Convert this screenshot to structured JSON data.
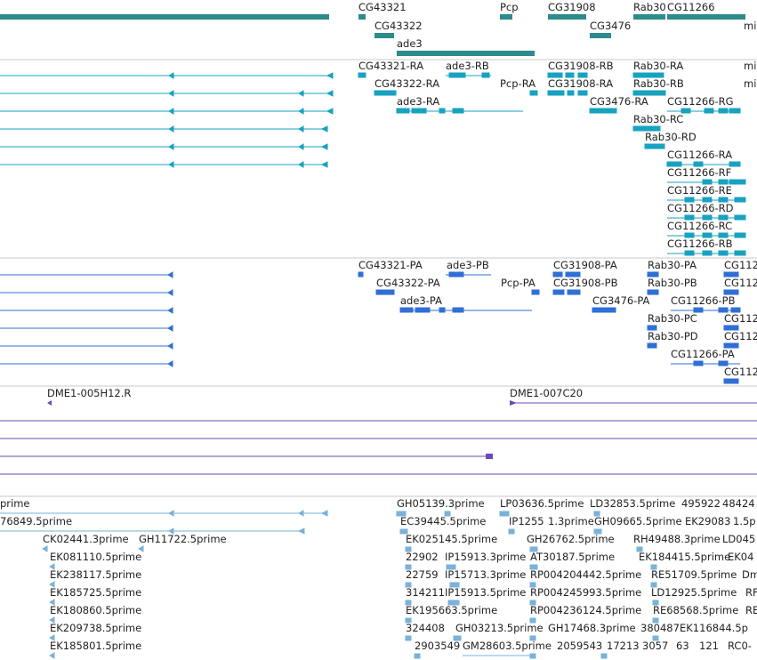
{
  "colors": {
    "gene": "#2e8b8b",
    "mrna": "#17a2bf",
    "protein": "#2f6fd6",
    "clone": "#6a4bb5",
    "est": "#7ab2d8",
    "separator": "#c8c8c8"
  },
  "tracks": {
    "genes": {
      "labels": [
        "CG43321",
        "Pcp",
        "CG31908",
        "Rab30",
        "CG11266",
        "CG43322",
        "CG3476",
        "ade3",
        "mi"
      ]
    },
    "mrna": {
      "labels": [
        "CG43321-RA",
        "ade3-RB",
        "CG31908-RB",
        "Rab30-RA",
        "mi",
        "CG43322-RA",
        "Pcp-RA",
        "CG31908-RA",
        "Rab30-RB",
        "mi",
        "ade3-RA",
        "CG3476-RA",
        "CG11266-RG",
        "Rab30-RC",
        "Rab30-RD",
        "CG11266-RA",
        "CG11266-RF",
        "CG11266-RE",
        "CG11266-RD",
        "CG11266-RC",
        "CG11266-RB"
      ]
    },
    "proteins": {
      "labels": [
        "CG43321-PA",
        "ade3-PB",
        "CG31908-PA",
        "Rab30-PA",
        "CG112",
        "CG43322-PA",
        "Pcp-PA",
        "CG31908-PB",
        "Rab30-PB",
        "CG112",
        "ade3-PA",
        "CG3476-PA",
        "CG11266-PB",
        "Rab30-PC",
        "CG112",
        "Rab30-PD",
        "CG112",
        "CG11266-PA",
        "CG112"
      ]
    },
    "clones": {
      "labels": [
        "DME1-005H12.R",
        "DME1-007C20"
      ]
    },
    "est": {
      "labels": [
        "prime",
        "GH05139.3prime",
        "LP03636.5prime",
        "LD32853.5prime",
        "495922",
        "48424",
        "76849.5prime",
        "EC39445.5prime",
        "IP1255",
        "1.3prime",
        "GH09665.5prime",
        "EK29083",
        "1.5p",
        "CK02441.3prime",
        "GH11722.5prime",
        "EK025145.5prime",
        "GH26762.5prime",
        "RH49488.3prime",
        "LD045",
        "EK081110.5prime",
        "22902",
        "IP15913.3prime",
        "AT30187.5prime",
        "EK184415.5prime",
        "EK04",
        "EK238117.5prime",
        "22759",
        "IP15713.3prime",
        "RP004204442.5prime",
        "RE51709.5prime",
        "Dm",
        "EK185725.5prime",
        "314211",
        "IP15913.5prime",
        "RP004245993.5prime",
        "LD12925.5prime",
        "RF",
        "EK180860.5prime",
        "EK195663.5prime",
        "RP004236124.5prime",
        "RE68568.5prime",
        "RE",
        "EK209738.5prime",
        "324408",
        "GH03213.5prime",
        "GH17468.3prime",
        "380487",
        "EK116844.5p",
        "EK185801.5prime",
        "2903549",
        "GM28603.5prime",
        "2059543",
        "17213",
        "3057",
        "63",
        "121",
        "RC0-"
      ]
    }
  }
}
